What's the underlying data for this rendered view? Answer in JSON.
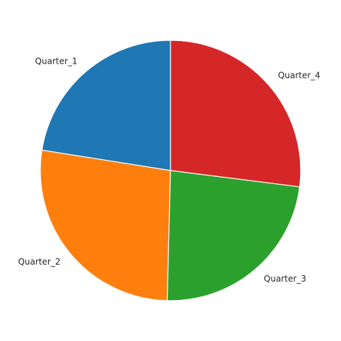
{
  "chart_data": {
    "type": "pie",
    "title": "",
    "categories": [
      "Quarter_1",
      "Quarter_2",
      "Quarter_3",
      "Quarter_4"
    ],
    "values": [
      22.5,
      27.1,
      23.4,
      27.0
    ],
    "colors": [
      "#1f77b4",
      "#ff7f0e",
      "#2ca02c",
      "#d62728"
    ],
    "start_angle_deg": 90,
    "direction": "counterclockwise"
  }
}
